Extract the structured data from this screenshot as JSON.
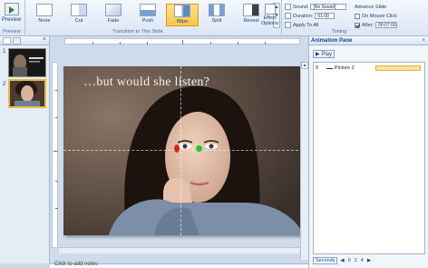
{
  "ribbon": {
    "preview": {
      "label": "Preview",
      "group": "Preview"
    },
    "transitions": [
      {
        "label": "None"
      },
      {
        "label": "Cut"
      },
      {
        "label": "Fade"
      },
      {
        "label": "Push"
      },
      {
        "label": "Wipe",
        "selected": true
      },
      {
        "label": "Split"
      },
      {
        "label": "Reveal"
      }
    ],
    "transitions_group": "Transition to This Slide",
    "effect_options": "Effect Options",
    "timing": {
      "sound_label": "Sound:",
      "sound_value": "[No Sound]",
      "duration_label": "Duration:",
      "duration_value": "01.00",
      "apply_all": "Apply To All",
      "advance_label": "Advance Slide",
      "on_click": "On Mouse Click",
      "after_label": "After:",
      "after_value": "00:07.00",
      "group": "Timing"
    }
  },
  "slides": [
    {
      "number": "1"
    },
    {
      "number": "2"
    }
  ],
  "slide": {
    "title": "…but would she listen?"
  },
  "animation_pane": {
    "title": "Animation Pane",
    "play": "Play",
    "items": [
      {
        "number": "0",
        "name": "Picture 2"
      }
    ],
    "seconds": "Seconds",
    "pages": [
      "0",
      "2",
      "4"
    ]
  },
  "notes": {
    "placeholder": "Click to add notes"
  },
  "colors": {
    "accent": "#f8c64b",
    "ribbon": "#dbe6f4",
    "selection": "#f0b840"
  }
}
